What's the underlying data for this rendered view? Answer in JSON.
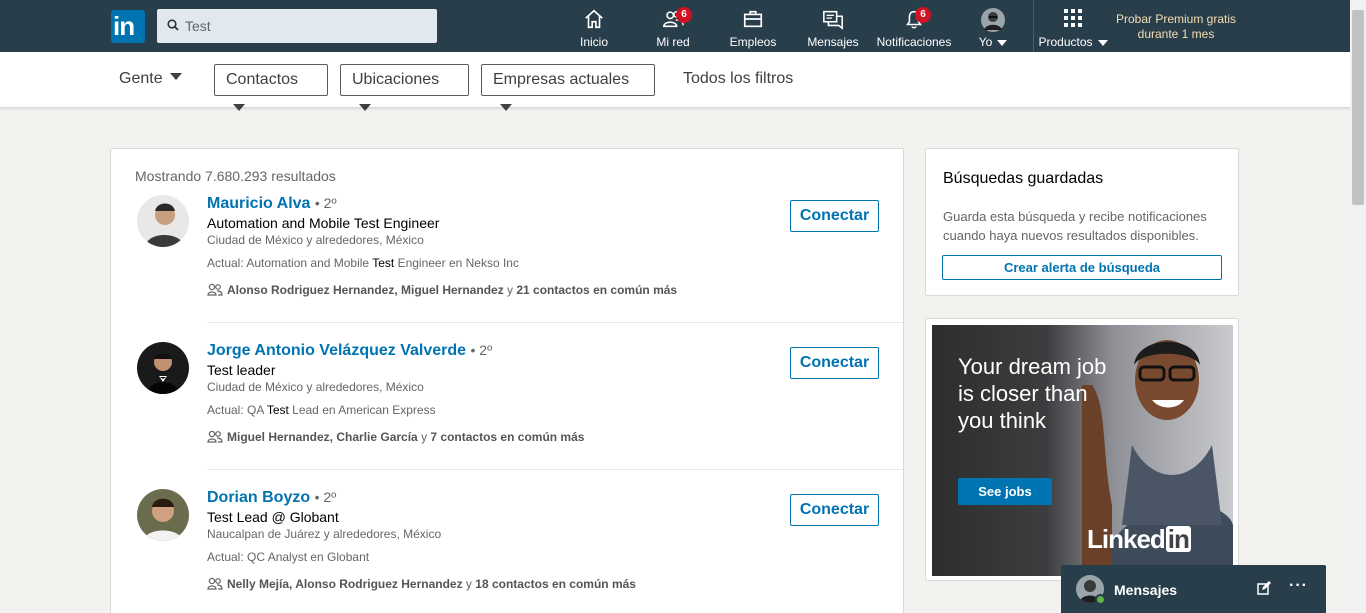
{
  "nav": {
    "logo": "in",
    "search_value": "Test",
    "items": [
      {
        "label": "Inicio",
        "icon": "home-icon"
      },
      {
        "label": "Mi red",
        "icon": "network-icon",
        "badge": "6"
      },
      {
        "label": "Empleos",
        "icon": "briefcase-icon"
      },
      {
        "label": "Mensajes",
        "icon": "messaging-icon"
      },
      {
        "label": "Notificaciones",
        "icon": "bell-icon",
        "badge": "6"
      },
      {
        "label": "Yo",
        "icon": "avatar"
      },
      {
        "label": "Productos",
        "icon": "grid-icon"
      }
    ],
    "premium_line1": "Probar Premium gratis",
    "premium_line2": "durante 1 mes"
  },
  "filters": {
    "people": "Gente",
    "contacts": "Contactos",
    "locations": "Ubicaciones",
    "companies": "Empresas actuales",
    "all": "Todos los filtros"
  },
  "results": {
    "count_text": "Mostrando 7.680.293 resultados",
    "connect_label": "Conectar",
    "items": [
      {
        "name": "Mauricio Alva",
        "degree": "• 2º",
        "headline": "Automation and Mobile Test Engineer",
        "location": "Ciudad de México y alrededores, México",
        "current_prefix": "Actual: Automation and Mobile ",
        "current_highlight": "Test",
        "current_suffix": " Engineer en Nekso Inc",
        "shared_names": "Alonso Rodriguez Hernandez, Miguel Hernandez",
        "shared_rest": " y ",
        "shared_count": "21 contactos en común más"
      },
      {
        "name": "Jorge Antonio Velázquez Valverde",
        "degree": "• 2º",
        "headline": "Test leader",
        "location": "Ciudad de México y alrededores, México",
        "current_prefix": "Actual: QA ",
        "current_highlight": "Test",
        "current_suffix": " Lead en American Express",
        "shared_names": "Miguel Hernandez, Charlie García",
        "shared_rest": " y ",
        "shared_count": "7 contactos en común más"
      },
      {
        "name": "Dorian Boyzo",
        "degree": "• 2º",
        "headline": "Test Lead @ Globant",
        "location": "Naucalpan de Juárez y alrededores, México",
        "current_prefix": "Actual: QC Analyst en Globant",
        "current_highlight": "",
        "current_suffix": "",
        "shared_names": "Nelly Mejía, Alonso Rodriguez Hernandez",
        "shared_rest": " y ",
        "shared_count": "18 contactos en común más"
      }
    ]
  },
  "saved": {
    "title": "Búsquedas guardadas",
    "description": "Guarda esta búsqueda y recibe notificaciones cuando haya nuevos resultados disponibles.",
    "button": "Crear alerta de búsqueda"
  },
  "ad": {
    "headline": "Your dream job is closer than you think",
    "cta": "See jobs",
    "brand_text": "Linked",
    "brand_in": "in"
  },
  "messaging": {
    "label": "Mensajes",
    "more": "···"
  },
  "colors": {
    "nav_bg": "#283e4a",
    "link": "#0073b1",
    "badge": "#d11124",
    "premium": "#f5deb3"
  }
}
